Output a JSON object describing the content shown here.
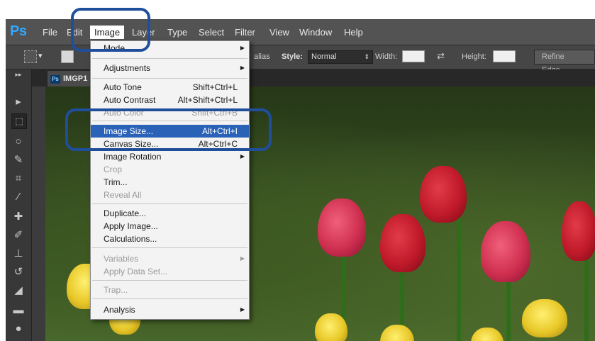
{
  "app": {
    "logo": "Ps",
    "menubar": [
      "File",
      "Edit",
      "Image",
      "Layer",
      "Type",
      "Select",
      "Filter",
      "View",
      "Window",
      "Help"
    ],
    "active_menu": "Image"
  },
  "options_bar": {
    "alias_text": "alias",
    "style_label": "Style:",
    "style_value": "Normal",
    "width_label": "Width:",
    "height_label": "Height:",
    "swap_icon": "⇄",
    "refine_edge": "Refine Edge..."
  },
  "document": {
    "tab_badge": "Ps",
    "tab_title": "IMGP1"
  },
  "image_menu": {
    "items": [
      {
        "label": "Mode",
        "submenu": true
      },
      {
        "label": "Adjustments",
        "submenu": true
      },
      {
        "label": "Auto Tone",
        "shortcut": "Shift+Ctrl+L"
      },
      {
        "label": "Auto Contrast",
        "shortcut": "Alt+Shift+Ctrl+L"
      },
      {
        "label": "Auto Color",
        "shortcut": "Shift+Ctrl+B",
        "disabled": true
      },
      {
        "label": "Image Size...",
        "shortcut": "Alt+Ctrl+I",
        "highlighted": true
      },
      {
        "label": "Canvas Size...",
        "shortcut": "Alt+Ctrl+C"
      },
      {
        "label": "Image Rotation",
        "submenu": true
      },
      {
        "label": "Crop",
        "disabled": true
      },
      {
        "label": "Trim..."
      },
      {
        "label": "Reveal All",
        "disabled": true
      },
      {
        "label": "Duplicate..."
      },
      {
        "label": "Apply Image..."
      },
      {
        "label": "Calculations..."
      },
      {
        "label": "Variables",
        "submenu": true,
        "disabled": true
      },
      {
        "label": "Apply Data Set...",
        "disabled": true
      },
      {
        "label": "Trap...",
        "disabled": true
      },
      {
        "label": "Analysis",
        "submenu": true
      }
    ]
  },
  "colors": {
    "highlight": "#2a62b8",
    "callout": "#1f4f9a",
    "logo": "#31a8ff"
  }
}
